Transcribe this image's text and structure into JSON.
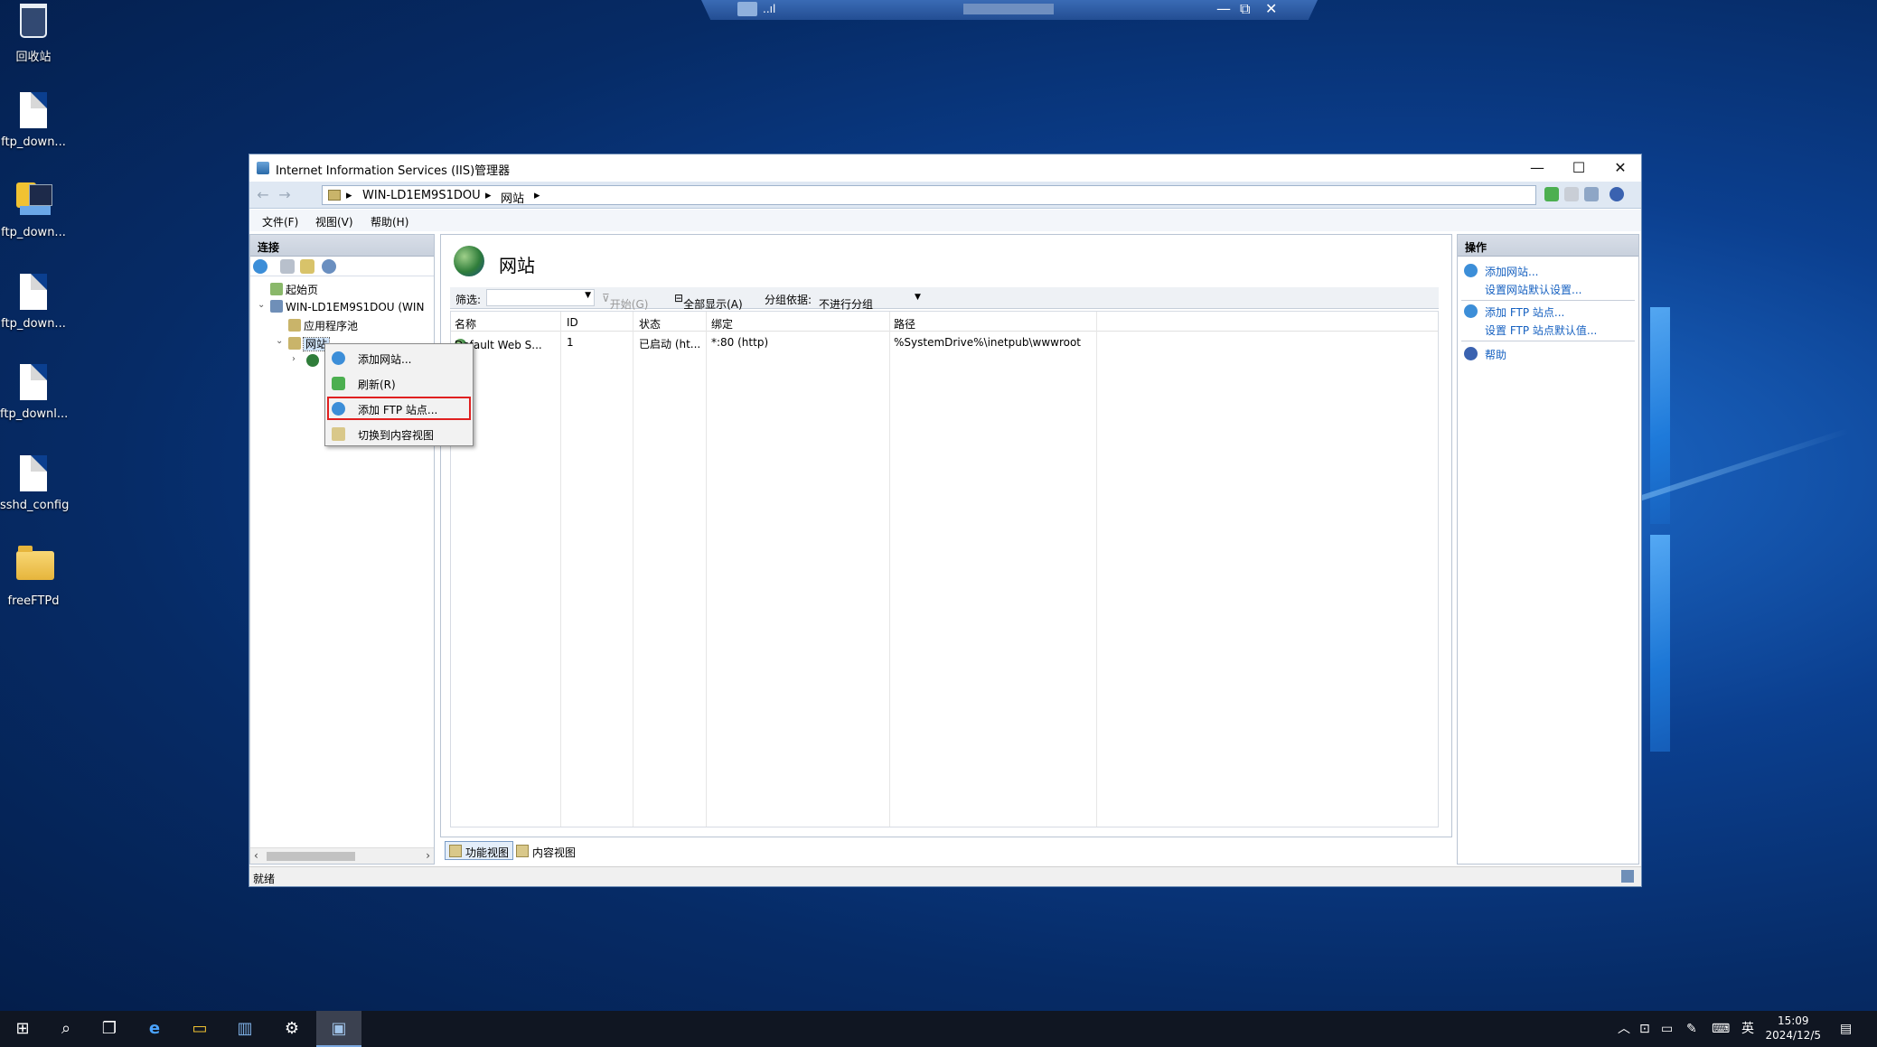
{
  "desktop": {
    "icons": [
      {
        "label": "回收站",
        "icon": "recycle-bin-icon"
      },
      {
        "label": "ftp_down...",
        "icon": "file-icon"
      },
      {
        "label": "ftp_down...",
        "icon": "powershell-script-icon"
      },
      {
        "label": "ftp_down...",
        "icon": "file-icon"
      },
      {
        "label": "ftp_downl...",
        "icon": "file-icon"
      },
      {
        "label": "sshd_config",
        "icon": "file-icon"
      },
      {
        "label": "freeFTPd",
        "icon": "folder-shortcut-icon"
      }
    ]
  },
  "rdp_bar": {
    "signal": "..ıl",
    "restore": "⧉",
    "minimize": "—",
    "close": "✕"
  },
  "window": {
    "title": "Internet Information Services (IIS)管理器",
    "controls": {
      "minimize": "—",
      "maximize": "☐",
      "close": "✕"
    },
    "address": {
      "parts": [
        "WIN-LD1EM9S1DOU",
        "网站"
      ],
      "sep": "▸"
    },
    "menu": [
      "文件(F)",
      "视图(V)",
      "帮助(H)"
    ],
    "connections": {
      "title": "连接",
      "tree": [
        {
          "label": "起始页"
        },
        {
          "label": "WIN-LD1EM9S1DOU (WIN"
        },
        {
          "label": "应用程序池"
        },
        {
          "label": "网站"
        }
      ]
    },
    "context_menu": [
      {
        "label": "添加网站..."
      },
      {
        "label": "刷新(R)"
      },
      {
        "label": "添加 FTP 站点...",
        "highlighted": true
      },
      {
        "label": "切换到内容视图"
      }
    ],
    "main": {
      "title": "网站",
      "filter": {
        "label": "筛选:",
        "start": "开始(G)",
        "show_all": "全部显示(A)",
        "group_label": "分组依据:",
        "group_value": "不进行分组"
      },
      "columns": [
        "名称",
        "ID",
        "状态",
        "绑定",
        "路径"
      ],
      "rows": [
        {
          "name": "Default Web S...",
          "id": "1",
          "status": "已启动 (ht...",
          "binding": "*:80 (http)",
          "path": "%SystemDrive%\\inetpub\\wwwroot"
        }
      ],
      "view_tabs": [
        "功能视图",
        "内容视图"
      ]
    },
    "actions": {
      "title": "操作",
      "items": [
        "添加网站...",
        "设置网站默认设置...",
        "添加 FTP 站点...",
        "设置 FTP 站点默认值...",
        "帮助"
      ]
    },
    "status": "就绪"
  },
  "taskbar": {
    "clock_time": "15:09",
    "clock_date": "2024/12/5",
    "ime": "英",
    "colors": {
      "accent": "#1560c0",
      "highlight_border": "#e02020"
    }
  }
}
